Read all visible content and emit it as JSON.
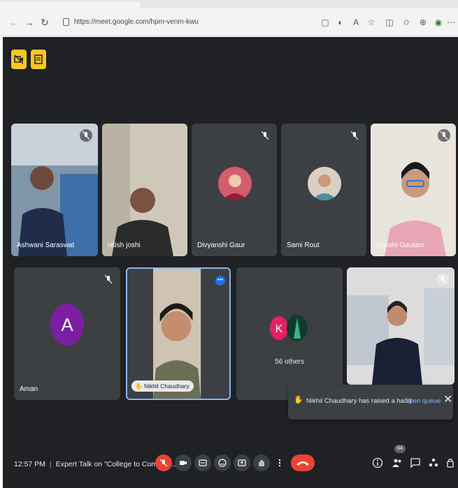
{
  "browser": {
    "url": "https://meet.google.com/hpm-venm-kwu"
  },
  "participants": [
    {
      "name": "Ashwani Saraswat"
    },
    {
      "name": "nitish joshi"
    },
    {
      "name": "Divyanshi Gaur"
    },
    {
      "name": "Sami Rout"
    },
    {
      "name": "Khushi Gautam"
    },
    {
      "name": "Aman",
      "initial": "A"
    },
    {
      "name": "Nikhil Chaudhary"
    }
  ],
  "others_tile": {
    "initial": "K",
    "label": "56 others"
  },
  "hand_notification": {
    "text": "Nikhil Chaudhary has raised a hand",
    "action": "Open queue",
    "close": "✕"
  },
  "bottom_bar": {
    "time": "12:57 PM",
    "separator": "|",
    "meeting_title": "Expert Talk on \"College to Compan...",
    "people_count": "64"
  },
  "colors": {
    "meet_bg": "#202124",
    "tile_bg": "#3c4043",
    "accent_red": "#ea4335",
    "badge_yellow": "#f9c623",
    "avatar_purple": "#7b1fa2",
    "avatar_pink": "#e91e63",
    "link_blue": "#8ab4f8"
  },
  "icons": {
    "top_left": [
      "camera-off-icon",
      "captions-icon"
    ],
    "controls": [
      "mic-off-icon",
      "camera-icon",
      "captions-icon",
      "emoji-icon",
      "present-icon",
      "raise-hand-icon",
      "more-options-icon",
      "end-call-icon"
    ],
    "right": [
      "info-icon",
      "people-icon",
      "chat-icon",
      "activities-icon",
      "host-controls-icon"
    ]
  }
}
